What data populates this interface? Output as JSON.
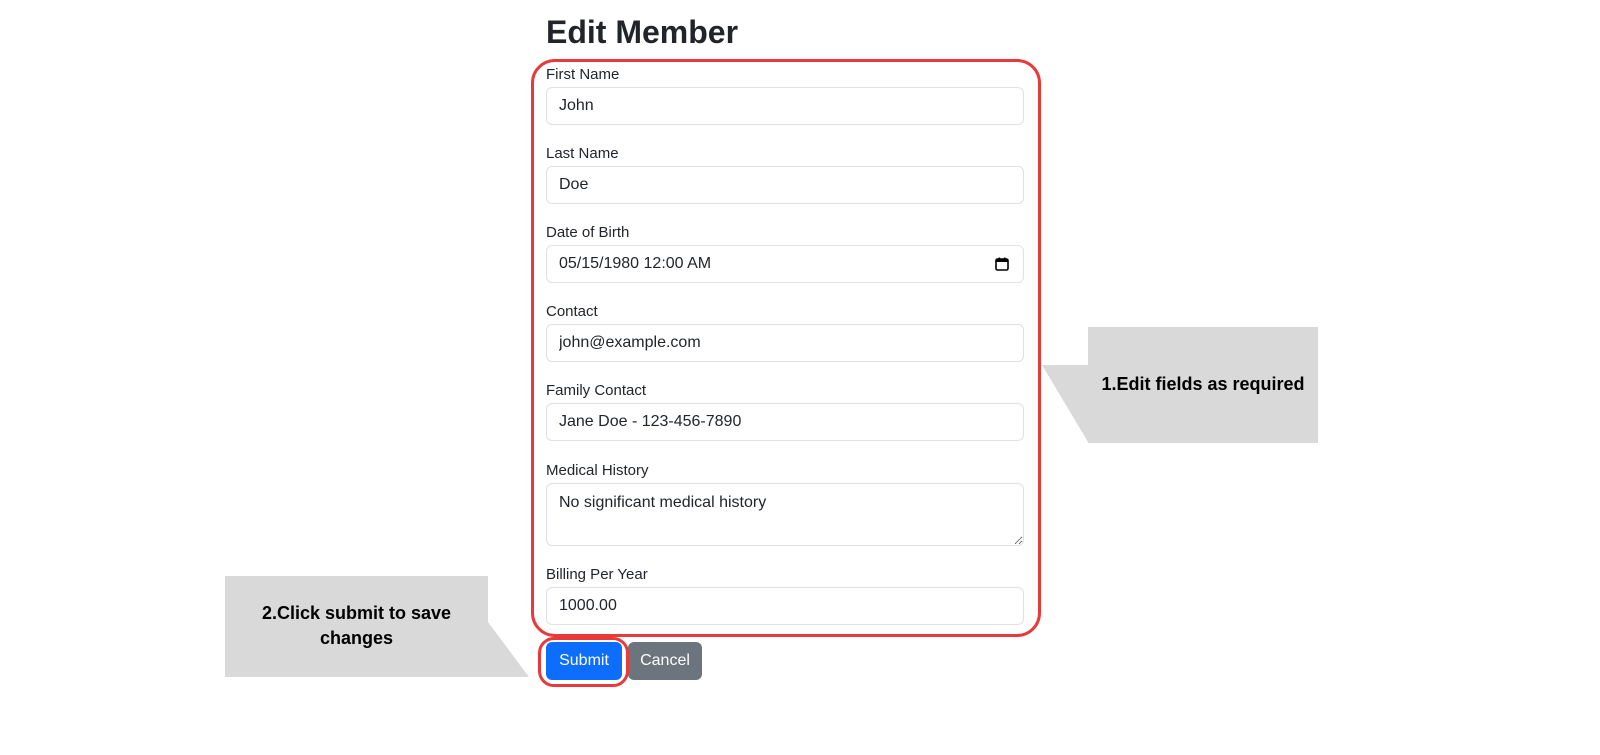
{
  "page": {
    "title": "Edit Member"
  },
  "form": {
    "first_name": {
      "label": "First Name",
      "value": "John"
    },
    "last_name": {
      "label": "Last Name",
      "value": "Doe"
    },
    "dob": {
      "label": "Date of Birth",
      "value": "05/15/1980 12:00  AM"
    },
    "contact": {
      "label": "Contact",
      "value": "john@example.com"
    },
    "family_contact": {
      "label": "Family Contact",
      "value": "Jane Doe - 123-456-7890"
    },
    "medical_history": {
      "label": "Medical History",
      "value": "No significant medical history"
    },
    "billing": {
      "label": "Billing Per Year",
      "value": "1000.00"
    }
  },
  "buttons": {
    "submit": "Submit",
    "cancel": "Cancel"
  },
  "annotations": {
    "step1": "1.Edit fields as required",
    "step2_line1": "2.Click submit to save",
    "step2_line2": "changes",
    "callout_color": "#d9d9d9",
    "highlight_color": "#e83a3a"
  },
  "colors": {
    "primary": "#0d6efd",
    "secondary": "#6c757d"
  }
}
